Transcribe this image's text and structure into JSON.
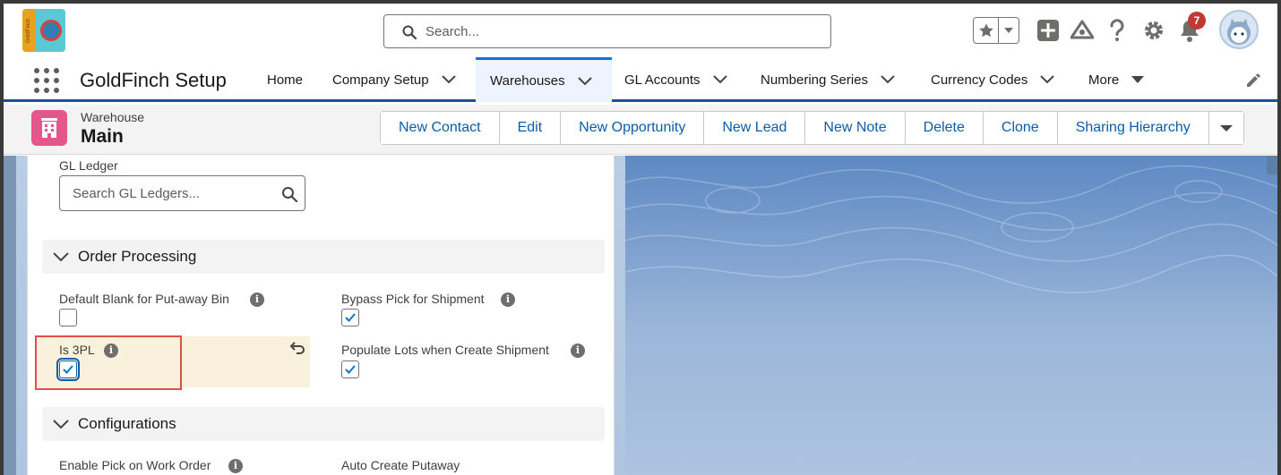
{
  "header": {
    "logo_text": "GoldFinch",
    "search_placeholder": "Search...",
    "notification_count": "7"
  },
  "nav": {
    "app_name": "GoldFinch Setup",
    "items": [
      {
        "label": "Home",
        "dropdown": false,
        "active": false
      },
      {
        "label": "Company Setup",
        "dropdown": true,
        "active": false
      },
      {
        "label": "Warehouses",
        "dropdown": true,
        "active": true
      },
      {
        "label": "GL Accounts",
        "dropdown": true,
        "active": false
      },
      {
        "label": "Numbering Series",
        "dropdown": true,
        "active": false
      },
      {
        "label": "Currency Codes",
        "dropdown": true,
        "active": false
      },
      {
        "label": "More",
        "dropdown": true,
        "active": false
      }
    ]
  },
  "record": {
    "object_type": "Warehouse",
    "name": "Main",
    "actions": [
      "New Contact",
      "Edit",
      "New Opportunity",
      "New Lead",
      "New Note",
      "Delete",
      "Clone",
      "Sharing Hierarchy"
    ]
  },
  "form": {
    "gl_ledger": {
      "label": "GL Ledger",
      "placeholder": "Search GL Ledgers..."
    },
    "sections": {
      "order_processing": "Order Processing",
      "configurations": "Configurations"
    },
    "fields": {
      "default_blank_putaway": {
        "label": "Default Blank for Put-away Bin",
        "checked": false
      },
      "bypass_pick_shipment": {
        "label": "Bypass Pick for Shipment",
        "checked": true
      },
      "is_3pl": {
        "label": "Is 3PL",
        "checked": true
      },
      "populate_lots": {
        "label": "Populate Lots when Create Shipment",
        "checked": true
      },
      "enable_pick_work_order": {
        "label": "Enable Pick on Work Order"
      },
      "auto_create_putaway": {
        "label": "Auto Create Putaway"
      }
    }
  },
  "colors": {
    "brand_blue": "#0176d3",
    "nav_active_border": "#1b5297",
    "link_blue": "#0b5cab",
    "object_icon": "#e3578a",
    "badge_red": "#c23934",
    "changed_field_bg": "#faf1dc",
    "highlight_outline": "#e04f44"
  }
}
